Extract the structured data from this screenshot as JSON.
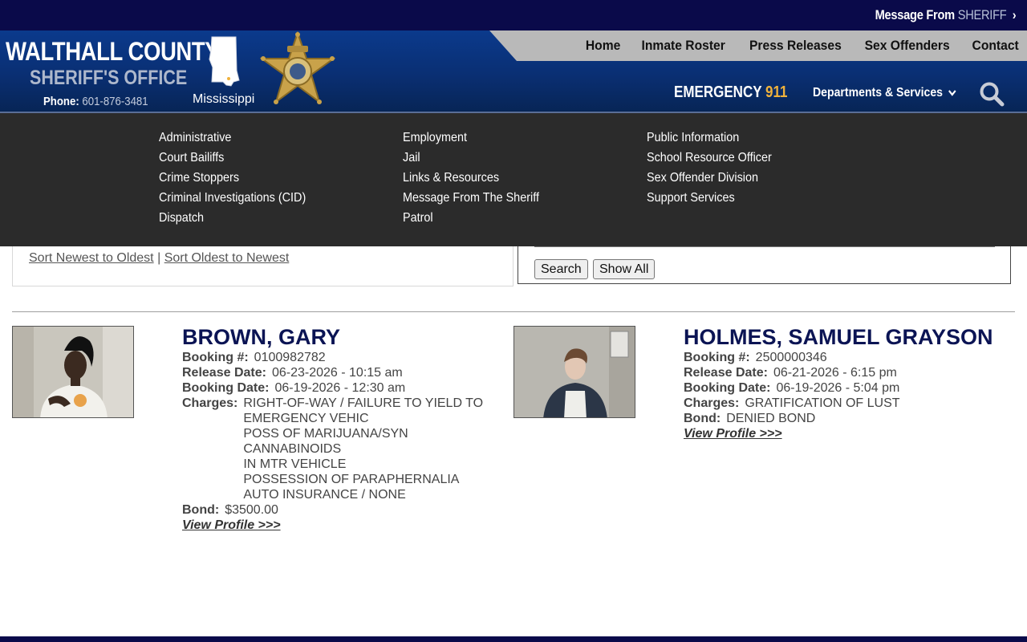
{
  "topbar": {
    "message_prefix": "Message From",
    "message_highlight": "SHERIFF",
    "chevron": "›"
  },
  "header": {
    "title_line1": "WALTHALL COUNTY",
    "title_line2": "SHERIFF'S OFFICE",
    "phone_label": "Phone:",
    "phone_number": "601-876-3481",
    "state_label": "Mississippi",
    "emergency_label": "EMERGENCY",
    "emergency_number": "911",
    "departments_label": "Departments & Services",
    "departments_icon": "chevron-down-icon",
    "nav": [
      "Home",
      "Inmate Roster",
      "Press Releases",
      "Sex Offenders",
      "Contact"
    ],
    "colors": {
      "top_bar": "#0a0a4a",
      "header_blue": "#0b3a8c",
      "nav_band": "#b9b9b9",
      "emergency_accent": "#f0b23c"
    }
  },
  "dropdown": {
    "column1": [
      "Administrative",
      "Court Bailiffs",
      "Crime Stoppers",
      "Criminal Investigations (CID)",
      "Dispatch"
    ],
    "column2": [
      "Employment",
      "Jail",
      "Links & Resources",
      "Message From The Sheriff",
      "Patrol"
    ],
    "column3": [
      "Public Information",
      "School Resource Officer",
      "Sex Offender Division",
      "Support Services"
    ]
  },
  "sort": {
    "newest": "Sort Newest to Oldest",
    "separator": "|",
    "oldest": "Sort Oldest to Newest"
  },
  "search": {
    "search_button": "Search",
    "show_all_button": "Show All"
  },
  "labels": {
    "booking": "Booking #:",
    "release": "Release Date:",
    "booking_date": "Booking Date:",
    "charges": "Charges:",
    "bond": "Bond:",
    "view_profile": "View Profile >>>"
  },
  "inmates": [
    {
      "name": "BROWN, GARY",
      "booking_number": "0100982782",
      "release_date": "06-23-2026 - 10:15 am",
      "booking_date": "06-19-2026 - 12:30 am",
      "charges": [
        "RIGHT-OF-WAY / FAILURE TO YIELD TO",
        "EMERGENCY VEHIC",
        "POSS OF MARIJUANA/SYN CANNABINOIDS",
        "IN MTR VEHICLE",
        "POSSESSION OF PARAPHERNALIA",
        "AUTO INSURANCE / NONE"
      ],
      "bond": "$3500.00"
    },
    {
      "name": "HOLMES, SAMUEL GRAYSON",
      "booking_number": "2500000346",
      "release_date": "06-21-2026 - 6:15 pm",
      "booking_date": "06-19-2026 - 5:04 pm",
      "charges": [
        "GRATIFICATION OF LUST"
      ],
      "bond": "DENIED BOND"
    }
  ]
}
